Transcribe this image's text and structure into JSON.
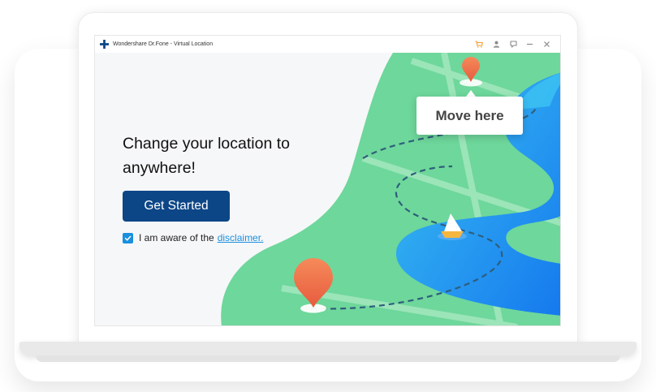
{
  "window": {
    "title": "Wondershare Dr.Fone - Virtual Location",
    "controls": [
      {
        "name": "cart-icon",
        "color": "#f39c2b"
      },
      {
        "name": "user-icon",
        "color": "#888888"
      },
      {
        "name": "feedback-icon",
        "color": "#888888"
      },
      {
        "name": "minimize-icon",
        "color": "#888888"
      },
      {
        "name": "close-icon",
        "color": "#888888"
      }
    ]
  },
  "main": {
    "headline": "Change your location to anywhere!",
    "cta_label": "Get Started",
    "consent_text": "I am aware of the",
    "disclaimer_link": "disclaimer.",
    "consent_checked": true
  },
  "map": {
    "tooltip_label": "Move here"
  },
  "colors": {
    "primary_button": "#0d4687",
    "link": "#1a8fde",
    "map_land": "#6fd79c",
    "map_water": "#1f8ef0",
    "pin": "#f06f4b"
  }
}
